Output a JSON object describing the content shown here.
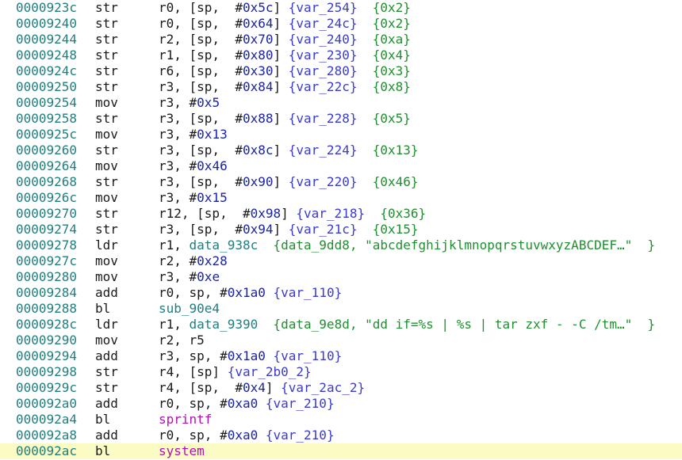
{
  "lines": [
    {
      "addr": "0000923c",
      "mn": "str",
      "ops": [
        [
          "reg",
          "r0, [sp,  #"
        ],
        [
          "num",
          "0x5c"
        ],
        [
          "txt",
          "] "
        ],
        [
          "var",
          "{var_254}"
        ],
        [
          "txt",
          "  "
        ],
        [
          "cmt",
          "{0x2}"
        ]
      ]
    },
    {
      "addr": "00009240",
      "mn": "str",
      "ops": [
        [
          "reg",
          "r0, [sp,  #"
        ],
        [
          "num",
          "0x64"
        ],
        [
          "txt",
          "] "
        ],
        [
          "var",
          "{var_24c}"
        ],
        [
          "txt",
          "  "
        ],
        [
          "cmt",
          "{0x2}"
        ]
      ]
    },
    {
      "addr": "00009244",
      "mn": "str",
      "ops": [
        [
          "reg",
          "r2, [sp,  #"
        ],
        [
          "num",
          "0x70"
        ],
        [
          "txt",
          "] "
        ],
        [
          "var",
          "{var_240}"
        ],
        [
          "txt",
          "  "
        ],
        [
          "cmt",
          "{0xa}"
        ]
      ]
    },
    {
      "addr": "00009248",
      "mn": "str",
      "ops": [
        [
          "reg",
          "r1, [sp,  #"
        ],
        [
          "num",
          "0x80"
        ],
        [
          "txt",
          "] "
        ],
        [
          "var",
          "{var_230}"
        ],
        [
          "txt",
          "  "
        ],
        [
          "cmt",
          "{0x4}"
        ]
      ]
    },
    {
      "addr": "0000924c",
      "mn": "str",
      "ops": [
        [
          "reg",
          "r6, [sp,  #"
        ],
        [
          "num",
          "0x30"
        ],
        [
          "txt",
          "] "
        ],
        [
          "var",
          "{var_280}"
        ],
        [
          "txt",
          "  "
        ],
        [
          "cmt",
          "{0x3}"
        ]
      ]
    },
    {
      "addr": "00009250",
      "mn": "str",
      "ops": [
        [
          "reg",
          "r3, [sp,  #"
        ],
        [
          "num",
          "0x84"
        ],
        [
          "txt",
          "] "
        ],
        [
          "var",
          "{var_22c}"
        ],
        [
          "txt",
          "  "
        ],
        [
          "cmt",
          "{0x8}"
        ]
      ]
    },
    {
      "addr": "00009254",
      "mn": "mov",
      "ops": [
        [
          "reg",
          "r3, #"
        ],
        [
          "num",
          "0x5"
        ]
      ]
    },
    {
      "addr": "00009258",
      "mn": "str",
      "ops": [
        [
          "reg",
          "r3, [sp,  #"
        ],
        [
          "num",
          "0x88"
        ],
        [
          "txt",
          "] "
        ],
        [
          "var",
          "{var_228}"
        ],
        [
          "txt",
          "  "
        ],
        [
          "cmt",
          "{0x5}"
        ]
      ]
    },
    {
      "addr": "0000925c",
      "mn": "mov",
      "ops": [
        [
          "reg",
          "r3, #"
        ],
        [
          "num",
          "0x13"
        ]
      ]
    },
    {
      "addr": "00009260",
      "mn": "str",
      "ops": [
        [
          "reg",
          "r3, [sp,  #"
        ],
        [
          "num",
          "0x8c"
        ],
        [
          "txt",
          "] "
        ],
        [
          "var",
          "{var_224}"
        ],
        [
          "txt",
          "  "
        ],
        [
          "cmt",
          "{0x13}"
        ]
      ]
    },
    {
      "addr": "00009264",
      "mn": "mov",
      "ops": [
        [
          "reg",
          "r3, #"
        ],
        [
          "num",
          "0x46"
        ]
      ]
    },
    {
      "addr": "00009268",
      "mn": "str",
      "ops": [
        [
          "reg",
          "r3, [sp,  #"
        ],
        [
          "num",
          "0x90"
        ],
        [
          "txt",
          "] "
        ],
        [
          "var",
          "{var_220}"
        ],
        [
          "txt",
          "  "
        ],
        [
          "cmt",
          "{0x46}"
        ]
      ]
    },
    {
      "addr": "0000926c",
      "mn": "mov",
      "ops": [
        [
          "reg",
          "r3, #"
        ],
        [
          "num",
          "0x15"
        ]
      ]
    },
    {
      "addr": "00009270",
      "mn": "str",
      "ops": [
        [
          "reg",
          "r12, [sp,  #"
        ],
        [
          "num",
          "0x98"
        ],
        [
          "txt",
          "] "
        ],
        [
          "var",
          "{var_218}"
        ],
        [
          "txt",
          "  "
        ],
        [
          "cmt",
          "{0x36}"
        ]
      ]
    },
    {
      "addr": "00009274",
      "mn": "str",
      "ops": [
        [
          "reg",
          "r3, [sp,  #"
        ],
        [
          "num",
          "0x94"
        ],
        [
          "txt",
          "] "
        ],
        [
          "var",
          "{var_21c}"
        ],
        [
          "txt",
          "  "
        ],
        [
          "cmt",
          "{0x15}"
        ]
      ]
    },
    {
      "addr": "00009278",
      "mn": "ldr",
      "ops": [
        [
          "reg",
          "r1, "
        ],
        [
          "sym",
          "data_938c"
        ],
        [
          "txt",
          "  "
        ],
        [
          "cmt",
          "{data_9dd8, \"abcdefghijklmnopqrstuvwxyzABCDEF…\"  }"
        ]
      ]
    },
    {
      "addr": "0000927c",
      "mn": "mov",
      "ops": [
        [
          "reg",
          "r2, #"
        ],
        [
          "num",
          "0x28"
        ]
      ]
    },
    {
      "addr": "00009280",
      "mn": "mov",
      "ops": [
        [
          "reg",
          "r3, #"
        ],
        [
          "num",
          "0xe"
        ]
      ]
    },
    {
      "addr": "00009284",
      "mn": "add",
      "ops": [
        [
          "reg",
          "r0, sp, #"
        ],
        [
          "num",
          "0x1a0"
        ],
        [
          "txt",
          " "
        ],
        [
          "var",
          "{var_110}"
        ]
      ]
    },
    {
      "addr": "00009288",
      "mn": "bl",
      "ops": [
        [
          "func",
          "sub_90e4"
        ]
      ]
    },
    {
      "addr": "0000928c",
      "mn": "ldr",
      "ops": [
        [
          "reg",
          "r1, "
        ],
        [
          "sym",
          "data_9390"
        ],
        [
          "txt",
          "  "
        ],
        [
          "cmt",
          "{data_9e8d, \"dd if=%s | %s | tar zxf - -C /tm…\"  }"
        ]
      ]
    },
    {
      "addr": "00009290",
      "mn": "mov",
      "ops": [
        [
          "reg",
          "r2, r5"
        ]
      ]
    },
    {
      "addr": "00009294",
      "mn": "add",
      "ops": [
        [
          "reg",
          "r3, sp, #"
        ],
        [
          "num",
          "0x1a0"
        ],
        [
          "txt",
          " "
        ],
        [
          "var",
          "{var_110}"
        ]
      ]
    },
    {
      "addr": "00009298",
      "mn": "str",
      "ops": [
        [
          "reg",
          "r4, [sp] "
        ],
        [
          "var",
          "{var_2b0_2}"
        ]
      ]
    },
    {
      "addr": "0000929c",
      "mn": "str",
      "ops": [
        [
          "reg",
          "r4, [sp,  #"
        ],
        [
          "num",
          "0x4"
        ],
        [
          "txt",
          "] "
        ],
        [
          "var",
          "{var_2ac_2}"
        ]
      ]
    },
    {
      "addr": "000092a0",
      "mn": "add",
      "ops": [
        [
          "reg",
          "r0, sp, #"
        ],
        [
          "num",
          "0xa0"
        ],
        [
          "txt",
          " "
        ],
        [
          "var",
          "{var_210}"
        ]
      ]
    },
    {
      "addr": "000092a4",
      "mn": "bl",
      "ops": [
        [
          "imp",
          "sprintf"
        ]
      ]
    },
    {
      "addr": "000092a8",
      "mn": "add",
      "ops": [
        [
          "reg",
          "r0, sp, #"
        ],
        [
          "num",
          "0xa0"
        ],
        [
          "txt",
          " "
        ],
        [
          "var",
          "{var_210}"
        ]
      ]
    },
    {
      "addr": "000092ac",
      "mn": "bl",
      "ops": [
        [
          "imp",
          "system"
        ]
      ],
      "highlighted": true
    }
  ]
}
